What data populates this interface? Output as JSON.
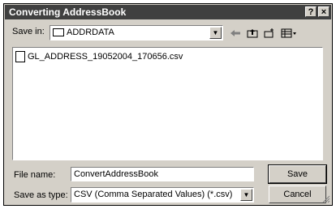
{
  "window": {
    "title": "Converting AddressBook",
    "help_label": "?",
    "close_label": "×"
  },
  "save_in": {
    "label": "Save in:",
    "folder": "ADDRDATA"
  },
  "toolbar": {
    "back_icon": "back-arrow-icon",
    "up_icon": "up-folder-icon",
    "new_folder_icon": "new-folder-icon",
    "view_menu_icon": "view-menu-icon"
  },
  "files": [
    {
      "name": "GL_ADDRESS_19052004_170656.csv"
    }
  ],
  "file_name": {
    "label": "File name:",
    "value": "ConvertAddressBook"
  },
  "save_as_type": {
    "label": "Save as type:",
    "value": "CSV (Comma Separated Values) (*.csv)"
  },
  "buttons": {
    "save": "Save",
    "cancel": "Cancel"
  }
}
